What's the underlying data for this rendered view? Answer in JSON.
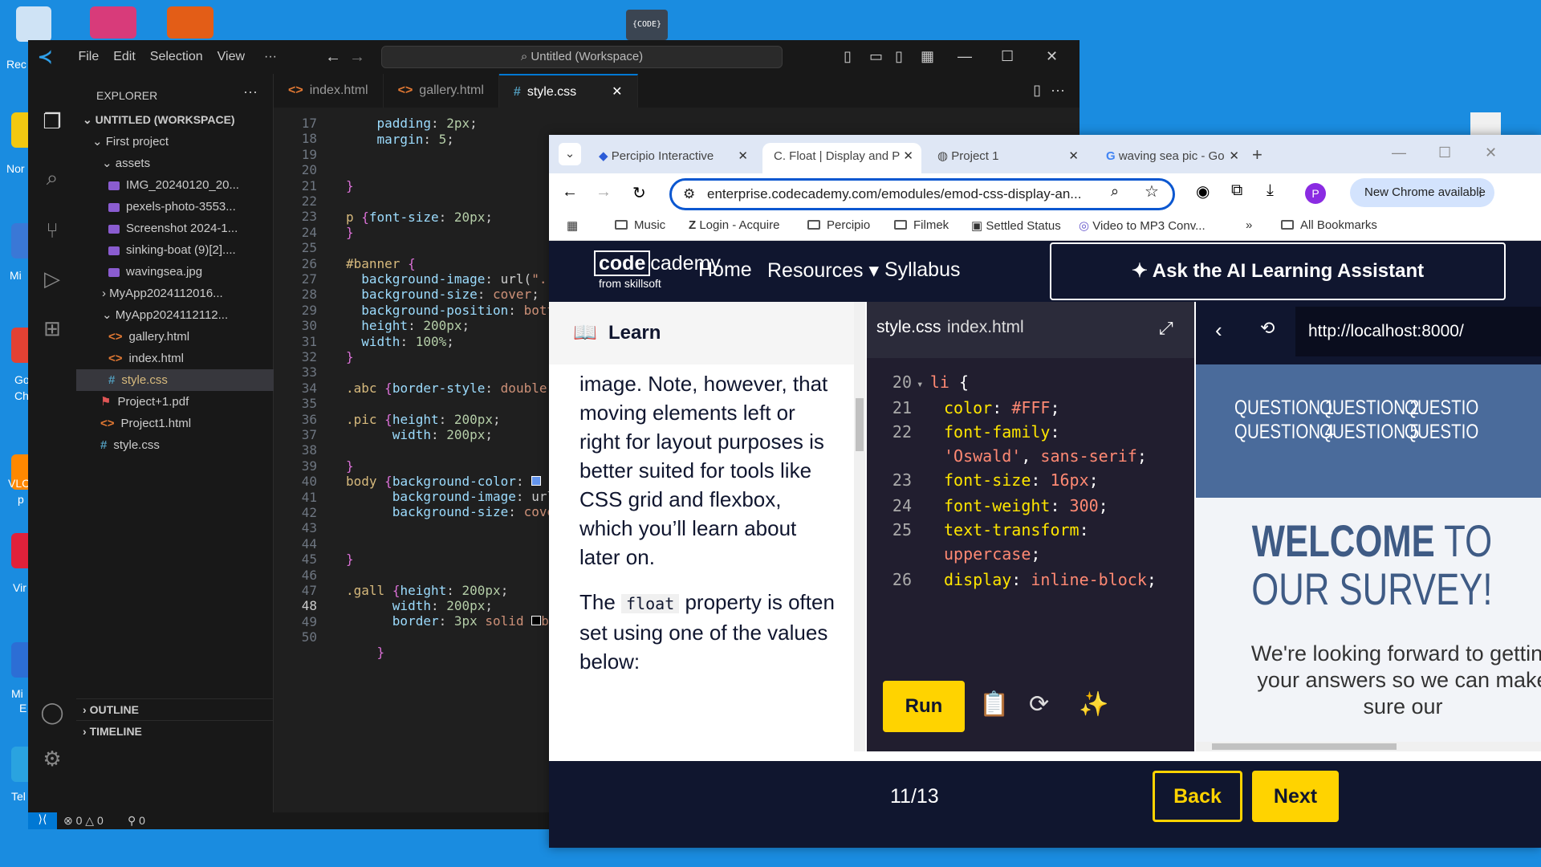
{
  "desktop": {
    "labels": [
      "Rec",
      "Nor",
      "Mi",
      "Go",
      "Ch",
      "VLC",
      "p",
      "Vir",
      "Mi",
      "E",
      "Tel"
    ],
    "code_label": "{CODE}"
  },
  "vscode": {
    "menu": [
      "File",
      "Edit",
      "Selection",
      "View",
      "···"
    ],
    "search": "Untitled (Workspace)",
    "explorer_title": "EXPLORER",
    "workspace": "UNTITLED (WORKSPACE)",
    "tree": [
      "First project",
      "assets",
      "IMG_20240120_20...",
      "pexels-photo-3553...",
      "Screenshot 2024-1...",
      "sinking-boat (9)[2]....",
      "wavingsea.jpg",
      "MyApp2024112016...",
      "MyApp2024112112...",
      "gallery.html",
      "index.html",
      "style.css",
      "Project+1.pdf",
      "Project1.html",
      "style.css"
    ],
    "outline": "OUTLINE",
    "timeline": "TIMELINE",
    "tabs": [
      "index.html",
      "gallery.html",
      "style.css"
    ],
    "line_numbers": [
      "17",
      "18",
      "19",
      "20",
      "21",
      "22",
      "23",
      "24",
      "25",
      "26",
      "27",
      "28",
      "29",
      "30",
      "31",
      "32",
      "33",
      "34",
      "35",
      "36",
      "37",
      "38",
      "39",
      "40",
      "41",
      "42",
      "43",
      "44",
      "45",
      "46",
      "47",
      "48",
      "49",
      "50"
    ],
    "status": {
      "errors": "0",
      "warnings": "0",
      "ports": "0"
    }
  },
  "chrome": {
    "tabs": [
      "Percipio Interactive",
      "Float | Display and P",
      "Project 1",
      "waving sea pic - Go"
    ],
    "url": "enterprise.codecademy.com/emodules/emod-css-display-an...",
    "new_chrome": "New Chrome available",
    "bookmarks": [
      "Music",
      "Login - Acquire",
      "Percipio",
      "Filmek",
      "Settled Status",
      "Video to MP3 Conv...",
      "All Bookmarks"
    ]
  },
  "codecademy": {
    "logo_a": "code",
    "logo_b": "cademy",
    "logo_sub": "from skillsoft",
    "nav": [
      "Home",
      "Resources ▾",
      "Syllabus"
    ],
    "ai_button": "Ask the AI Learning Assistant",
    "learn_title": "Learn",
    "learn_p1": "image. Note, however, that moving elements left or right for layout purposes is better suited for tools like CSS grid and flexbox, which you’ll learn about later on.",
    "learn_p2_a": "The ",
    "learn_p2_code": "float",
    "learn_p2_b": " property is often set using one of the values below:",
    "editor_tabs": [
      "style.css",
      "index.html"
    ],
    "run": "Run",
    "preview_url": "http://localhost:8000/",
    "questions": [
      "QUESTION 1",
      "QUESTION 2",
      "QUESTIO",
      "QUESTION 4",
      "QUESTION 5",
      "QUESTIO"
    ],
    "welcome_a": "WELCOME",
    "welcome_b": " TO OUR SURVEY!",
    "desc": "We're looking forward to getting your answers so we can make sure our",
    "counter": "11/13",
    "back": "Back",
    "next": "Next"
  }
}
